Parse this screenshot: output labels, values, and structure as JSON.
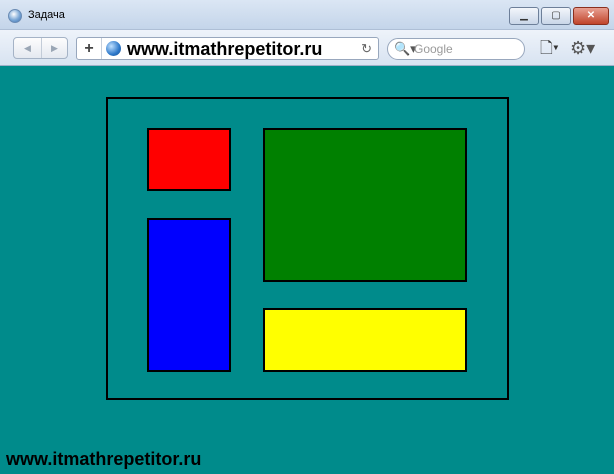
{
  "window": {
    "title": "Задача",
    "minimize_label": "▁",
    "maximize_label": "▢",
    "close_label": "✕"
  },
  "toolbar": {
    "back_label": "◀",
    "forward_label": "▶",
    "add_label": "+",
    "url": "www.itmathrepetitor.ru",
    "reload_label": "↻",
    "search_icon_label": "🔍▾",
    "search_placeholder": "Google",
    "page_menu_label": "🗋▾",
    "tools_menu_label": "⚙▾"
  },
  "canvas": {
    "background": "#008b8b",
    "shapes": [
      {
        "color": "#ff0000"
      },
      {
        "color": "#0000ff"
      },
      {
        "color": "#008000"
      },
      {
        "color": "#ffff00"
      }
    ]
  },
  "watermark": "www.itmathrepetitor.ru"
}
